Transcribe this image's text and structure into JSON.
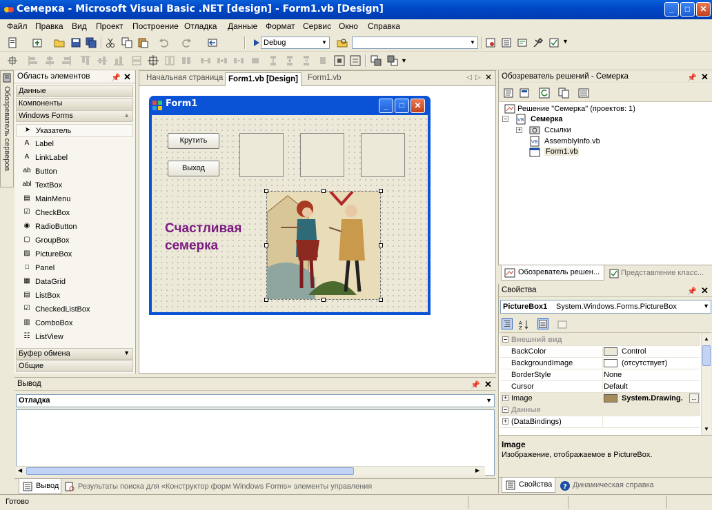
{
  "window": {
    "title": "Семерка - Microsoft Visual Basic .NET [design] - Form1.vb [Design]",
    "minimize": "_",
    "maximize": "□",
    "close": "✕"
  },
  "menu": [
    "Файл",
    "Правка",
    "Вид",
    "Проект",
    "Построение",
    "Отладка",
    "Данные",
    "Формат",
    "Сервис",
    "Окно",
    "Справка"
  ],
  "toolbar": {
    "config": "Debug",
    "platform": ""
  },
  "server_tab": "Обозреватель серверов",
  "toolbox": {
    "title": "Область элементов",
    "cat_data": "Данные",
    "cat_components": "Компоненты",
    "cat_winforms": "Windows Forms",
    "items": [
      {
        "label": "Указатель",
        "glyph": "➤"
      },
      {
        "label": "Label",
        "glyph": "A"
      },
      {
        "label": "LinkLabel",
        "glyph": "A"
      },
      {
        "label": "Button",
        "glyph": "ab"
      },
      {
        "label": "TextBox",
        "glyph": "abl"
      },
      {
        "label": "MainMenu",
        "glyph": "▤"
      },
      {
        "label": "CheckBox",
        "glyph": "☑"
      },
      {
        "label": "RadioButton",
        "glyph": "◉"
      },
      {
        "label": "GroupBox",
        "glyph": "▢"
      },
      {
        "label": "PictureBox",
        "glyph": "▨"
      },
      {
        "label": "Panel",
        "glyph": "□"
      },
      {
        "label": "DataGrid",
        "glyph": "▦"
      },
      {
        "label": "ListBox",
        "glyph": "▤"
      },
      {
        "label": "CheckedListBox",
        "glyph": "☑"
      },
      {
        "label": "ComboBox",
        "glyph": "▥"
      },
      {
        "label": "ListView",
        "glyph": "☷"
      }
    ],
    "cat_clipboard": "Буфер обмена",
    "cat_general": "Общие"
  },
  "doc_tabs": {
    "start": "Начальная страница",
    "design": "Form1.vb [Design]",
    "code": "Form1.vb"
  },
  "form": {
    "caption": "Form1",
    "btn_spin": "Крутить",
    "btn_exit": "Выход",
    "happy_line1": "Счастливая",
    "happy_line2": "семерка"
  },
  "solution": {
    "title": "Обозреватель решений - Семерка",
    "root": "Решение \"Семерка\" (проектов: 1)",
    "project": "Семерка",
    "refs": "Ссылки",
    "assembly": "AssemblyInfo.vb",
    "form": "Form1.vb",
    "tab_solution": "Обозреватель решен...",
    "tab_class": "Представление класс..."
  },
  "properties": {
    "title": "Свойства",
    "object": "PictureBox1",
    "type": "System.Windows.Forms.PictureBox",
    "cat_appearance": "Внешний вид",
    "rows": [
      {
        "name": "BackColor",
        "value": "Control"
      },
      {
        "name": "BackgroundImage",
        "value": "(отсутствует)"
      },
      {
        "name": "BorderStyle",
        "value": "None"
      },
      {
        "name": "Cursor",
        "value": "Default"
      },
      {
        "name": "Image",
        "value": "System.Drawing."
      }
    ],
    "cat_data": "Данные",
    "databindings": "(DataBindings)",
    "help_title": "Image",
    "help_text": "Изображение, отображаемое в PictureBox.",
    "tab_props": "Свойства",
    "tab_dyn": "Динамическая справка"
  },
  "output": {
    "title": "Вывод",
    "pane": "Отладка",
    "tab_output": "Вывод",
    "tab_search": "Результаты поиска для «Конструктор форм Windows Forms» элементы управления"
  },
  "status": "Готово",
  "colors": {
    "titlebar": "#0048c8",
    "happy_text": "#7b1a80"
  }
}
